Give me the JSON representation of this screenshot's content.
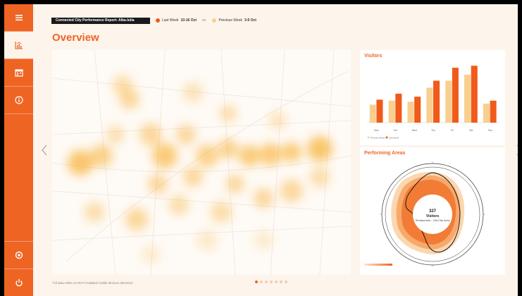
{
  "sidebar": {
    "items": [
      {
        "icon": "menu-icon"
      },
      {
        "icon": "chart-icon",
        "active": true
      },
      {
        "icon": "calendar-icon"
      },
      {
        "icon": "info-icon"
      },
      {
        "icon": "settings-icon"
      },
      {
        "icon": "power-icon"
      }
    ]
  },
  "header": {
    "report_title": "Connected City Performance Report: Alba-Iulia",
    "last_week_label": "Last Week",
    "last_week_dates": "10-16 Oct",
    "vs": "vs.",
    "prev_week_label": "Previous Week",
    "prev_week_dates": "3-9 Oct"
  },
  "colors": {
    "accent": "#ee6423",
    "last_week": "#f05a1a",
    "previous_week": "#f9cf8f",
    "panel_bg": "#fdf4ec"
  },
  "page_title": "Overview",
  "visitors": {
    "title": "Visitors"
  },
  "areas": {
    "title": "Performing Areas",
    "center_value": "327",
    "center_label": "Visitors",
    "center_sub": "Restaurants - Old City Area"
  },
  "footnote": "*All data relies on Wi-Fi enabled mobile devices detection",
  "pager": {
    "count": 7,
    "active": 0
  },
  "chart_data": {
    "type": "bar",
    "categories": [
      "Mon",
      "Tue",
      "Wed",
      "Thu",
      "Fri",
      "Sat",
      "Sun"
    ],
    "series": [
      {
        "name": "Previous Week",
        "values": [
          1800,
          2200,
          2100,
          3500,
          4200,
          4800,
          1900
        ]
      },
      {
        "name": "Last Week",
        "values": [
          2300,
          2900,
          2600,
          4200,
          5500,
          5700,
          2200
        ]
      }
    ]
  }
}
